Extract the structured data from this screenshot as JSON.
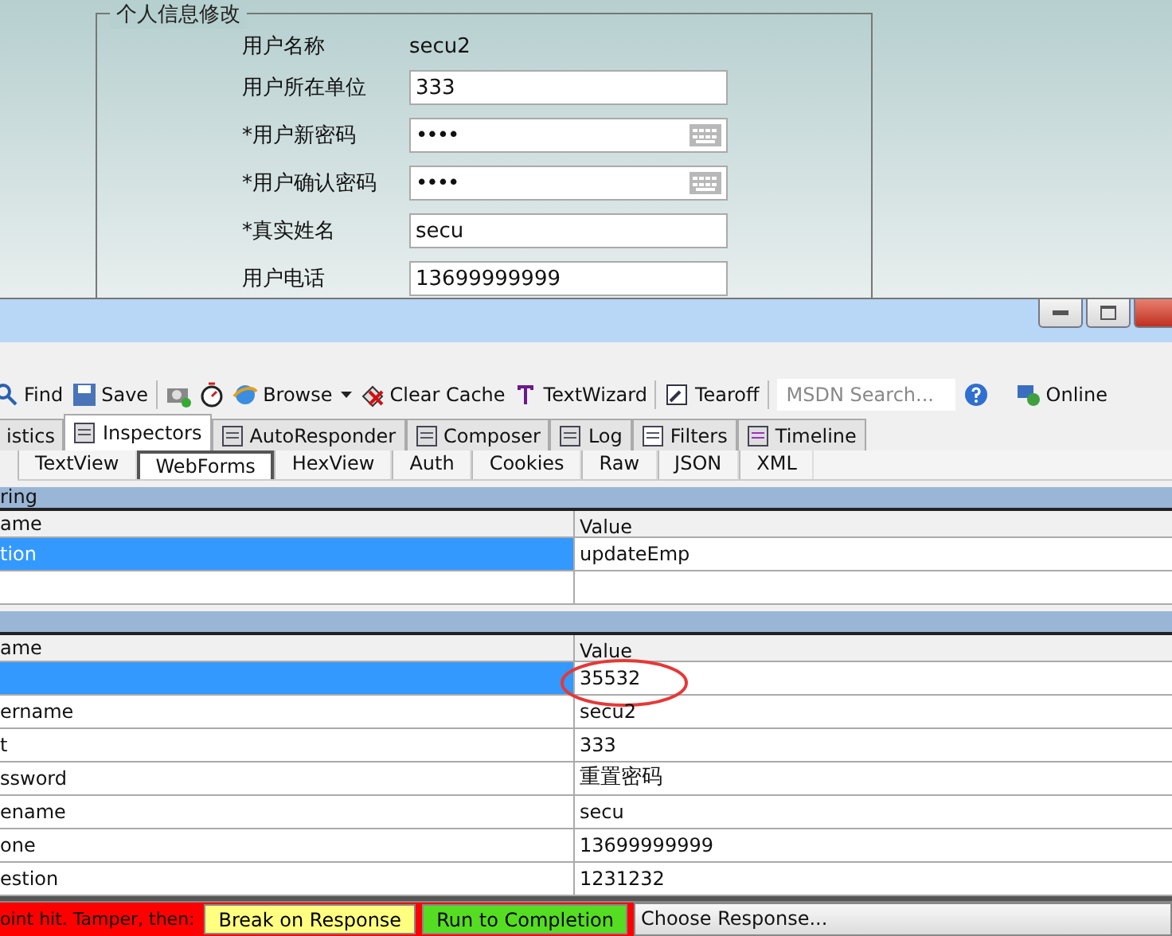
{
  "form": {
    "legend": "个人信息修改",
    "fields": [
      {
        "label": "用户名称",
        "kind": "plain",
        "value": "secu2"
      },
      {
        "label": "用户所在单位",
        "kind": "text",
        "value": "333"
      },
      {
        "label": "*用户新密码",
        "kind": "password",
        "value": "••••"
      },
      {
        "label": "*用户确认密码",
        "kind": "password",
        "value": "••••"
      },
      {
        "label": "*真实姓名",
        "kind": "text",
        "value": "secu"
      },
      {
        "label": "用户电话",
        "kind": "text",
        "value": "13699999999"
      }
    ]
  },
  "toolbar": {
    "items": [
      {
        "kind": "find",
        "label": "Find"
      },
      {
        "kind": "save",
        "label": "Save"
      },
      {
        "kind": "sep"
      },
      {
        "kind": "camera"
      },
      {
        "kind": "timer"
      },
      {
        "kind": "browse",
        "label": "Browse"
      },
      {
        "kind": "caret"
      },
      {
        "kind": "clear",
        "label": "Clear Cache"
      },
      {
        "kind": "wizard",
        "label": "TextWizard"
      },
      {
        "kind": "sep"
      },
      {
        "kind": "tearoff",
        "label": "Tearoff"
      },
      {
        "kind": "sep"
      },
      {
        "kind": "search",
        "placeholder": "MSDN Search..."
      },
      {
        "kind": "help"
      },
      {
        "kind": "online",
        "label": "Online"
      }
    ]
  },
  "tabs": [
    {
      "label": "istics",
      "selected": false
    },
    {
      "label": "Inspectors",
      "selected": true
    },
    {
      "label": "AutoResponder",
      "selected": false
    },
    {
      "label": "Composer",
      "selected": false
    },
    {
      "label": "Log",
      "selected": false
    },
    {
      "label": "Filters",
      "selected": false
    },
    {
      "label": "Timeline",
      "selected": false
    }
  ],
  "subtabs": [
    {
      "label": "TextView",
      "selected": false
    },
    {
      "label": "WebForms",
      "selected": true
    },
    {
      "label": "HexView",
      "selected": false
    },
    {
      "label": "Auth",
      "selected": false
    },
    {
      "label": "Cookies",
      "selected": false
    },
    {
      "label": "Raw",
      "selected": false
    },
    {
      "label": "JSON",
      "selected": false
    },
    {
      "label": "XML",
      "selected": false
    }
  ],
  "sections": [
    {
      "title": "ring",
      "columns": [
        "ame",
        "Value"
      ],
      "rows": [
        {
          "name": "tion",
          "value": "updateEmp",
          "selected": true
        },
        {
          "name": "",
          "value": "",
          "selected": false
        }
      ]
    },
    {
      "columns": [
        "ame",
        "Value"
      ],
      "rows": [
        {
          "name": "",
          "value": "35532",
          "selected": true,
          "circled": true
        },
        {
          "name": "ername",
          "value": "secu2",
          "selected": false
        },
        {
          "name": "t",
          "value": "333",
          "selected": false
        },
        {
          "name": "ssword",
          "value": "重置密码",
          "selected": false
        },
        {
          "name": "ename",
          "value": "secu",
          "selected": false
        },
        {
          "name": "one",
          "value": "13699999999",
          "selected": false
        },
        {
          "name": "estion",
          "value": "1231232",
          "selected": false
        }
      ]
    }
  ],
  "status_bar": {
    "message": "oint hit. Tamper, then:",
    "buttons": [
      {
        "kind": "yellow",
        "label": "Break on Response"
      },
      {
        "kind": "green",
        "label": "Run to Completion"
      }
    ],
    "dropdown": "Choose Response..."
  }
}
